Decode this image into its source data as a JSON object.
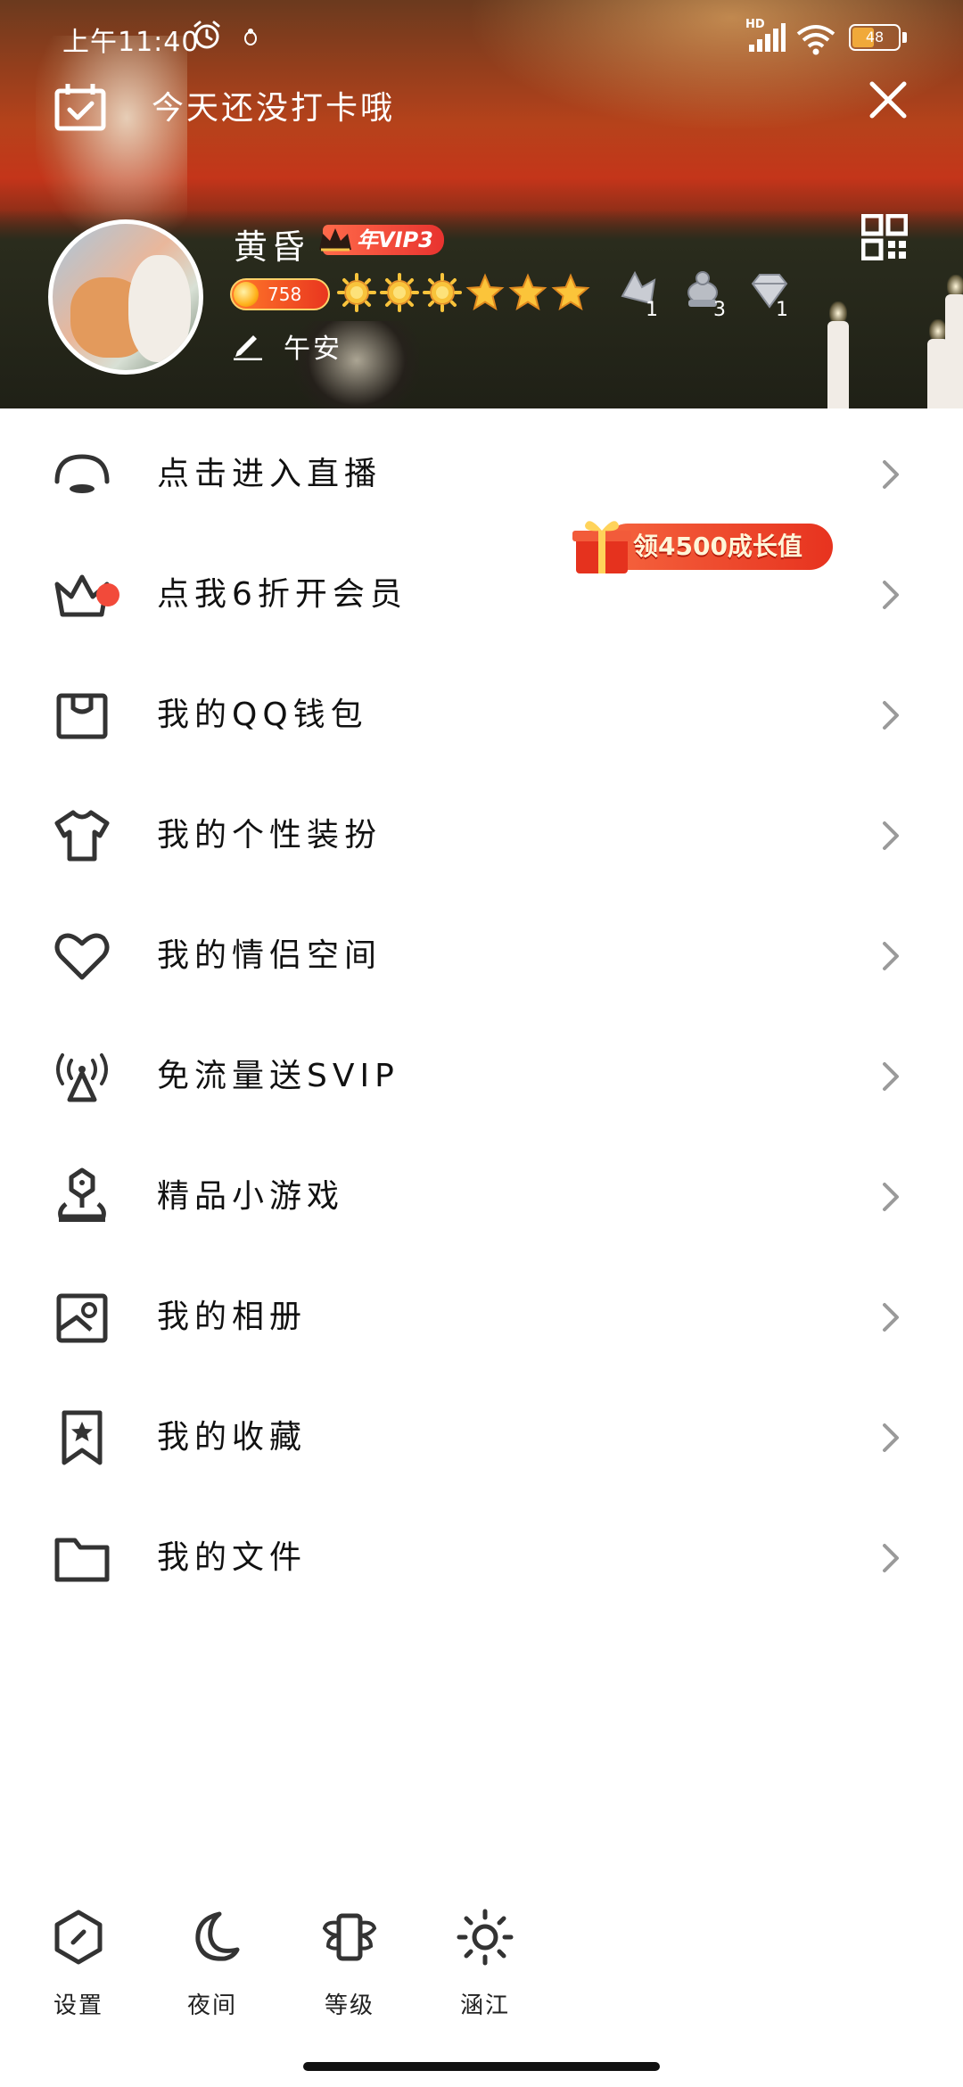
{
  "status_bar": {
    "time": "上午11:40",
    "network_badge": "HD",
    "battery_level": "48",
    "battery_fraction": 0.48
  },
  "header": {
    "checkin_text": "今天还没打卡哦",
    "username": "黄昏",
    "vip_badge": "年VIP3",
    "points": "758",
    "signature": "午安",
    "level_icons": [
      "sun-icon",
      "sun-icon",
      "sun-icon",
      "star-icon",
      "star-icon",
      "star-icon"
    ],
    "medals": [
      {
        "icon": "crystal-medal-icon",
        "count": "1"
      },
      {
        "icon": "turtle-medal-icon",
        "count": "3"
      },
      {
        "icon": "diamond-medal-icon",
        "count": "1"
      }
    ]
  },
  "menu": {
    "items": [
      {
        "label": "点击进入直播",
        "icon": "live-icon"
      },
      {
        "label": "点我6折开会员",
        "icon": "crown-icon",
        "promo": "领4500成长值"
      },
      {
        "label": "我的QQ钱包",
        "icon": "wallet-icon"
      },
      {
        "label": "我的个性装扮",
        "icon": "tshirt-icon"
      },
      {
        "label": "我的情侣空间",
        "icon": "heart-icon"
      },
      {
        "label": "免流量送SVIP",
        "icon": "antenna-icon"
      },
      {
        "label": "精品小游戏",
        "icon": "game-icon"
      },
      {
        "label": "我的相册",
        "icon": "photo-album-icon"
      },
      {
        "label": "我的收藏",
        "icon": "bookmark-star-icon"
      },
      {
        "label": "我的文件",
        "icon": "folder-icon"
      }
    ]
  },
  "bottom_bar": {
    "items": [
      {
        "label": "设置",
        "icon": "settings-icon"
      },
      {
        "label": "夜间",
        "icon": "moon-icon"
      },
      {
        "label": "等级",
        "icon": "level-badge-icon"
      },
      {
        "label": "涵江",
        "icon": "sun-weather-icon"
      }
    ]
  },
  "colors": {
    "accent_red": "#f24a3a",
    "header_orange": "#c4351a",
    "text_dark": "#111111",
    "chevron_gray": "#9a9a9a"
  }
}
